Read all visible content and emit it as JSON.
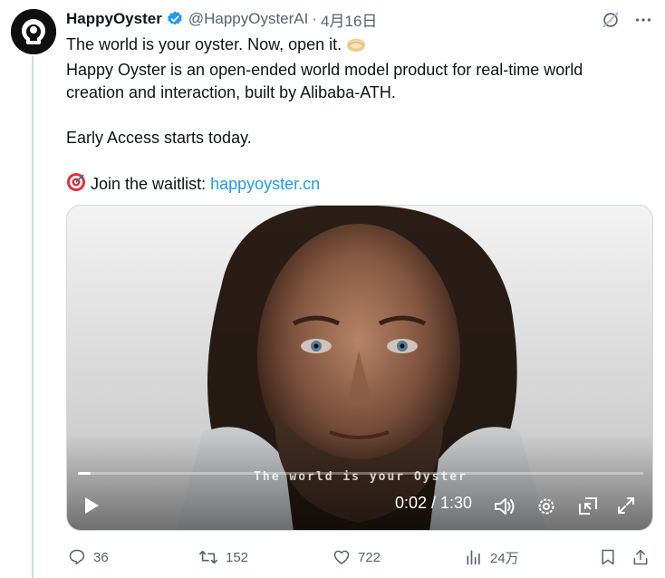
{
  "author": {
    "display_name": "HappyOyster",
    "handle": "@HappyOysterAI",
    "separator": "·",
    "date": "4月16日"
  },
  "tweet": {
    "line1": "The world is your oyster. Now, open it.",
    "line2": "Happy Oyster is an open-ended world model product for real-time world",
    "line3": "creation and interaction, built by Alibaba-ATH.",
    "line4": "Early Access starts today.",
    "line5_prefix": "Join the waitlist: ",
    "link": "happyoyster.cn"
  },
  "video": {
    "subtitle": "The world is your Oyster",
    "time": "0:02 / 1:30",
    "progress": 0.022
  },
  "actions": {
    "replies": "36",
    "reposts": "152",
    "likes": "722",
    "views": "24万"
  },
  "colors": {
    "accent": "#1d9bf0",
    "muted": "#536471",
    "text": "#0f1419"
  }
}
